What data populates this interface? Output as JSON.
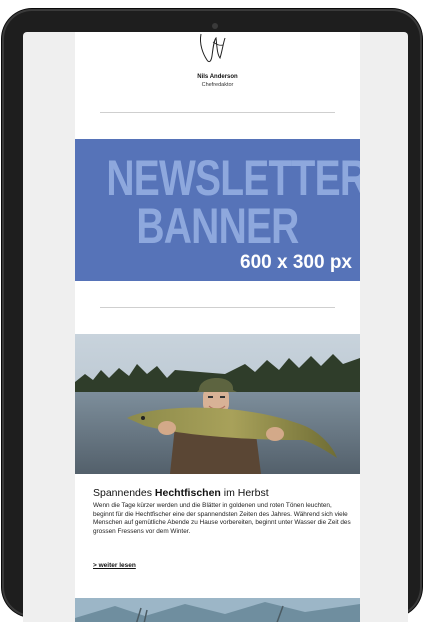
{
  "signature": {
    "name": "Nils Anderson",
    "role": "Chefredaktor"
  },
  "banner": {
    "line1": "NEWSLETTER-",
    "line2": "BANNER",
    "size": "600 x 300 px",
    "colors": {
      "background": "#5673b8",
      "headline": "#8ea8dd",
      "size_text": "#ffffff"
    }
  },
  "article": {
    "title_prefix": "Spannendes ",
    "title_bold": "Hechtfischen",
    "title_suffix": " im Herbst",
    "body": "Wenn die Tage kürzer werden und die Blätter in goldenen und roten Tönen leuchten, beginnt für die Hechtfischer eine der spannendsten Zeiten des Jahres. Während sich viele Menschen auf gemütliche Abende zu Hause vorbereiten, beginnt unter Wasser die Zeit des grossen Fressens vor dem Winter.",
    "read_more": "> weiter lesen"
  },
  "icons": {
    "camera": "front-camera-icon",
    "signature": "handwritten-signature"
  }
}
